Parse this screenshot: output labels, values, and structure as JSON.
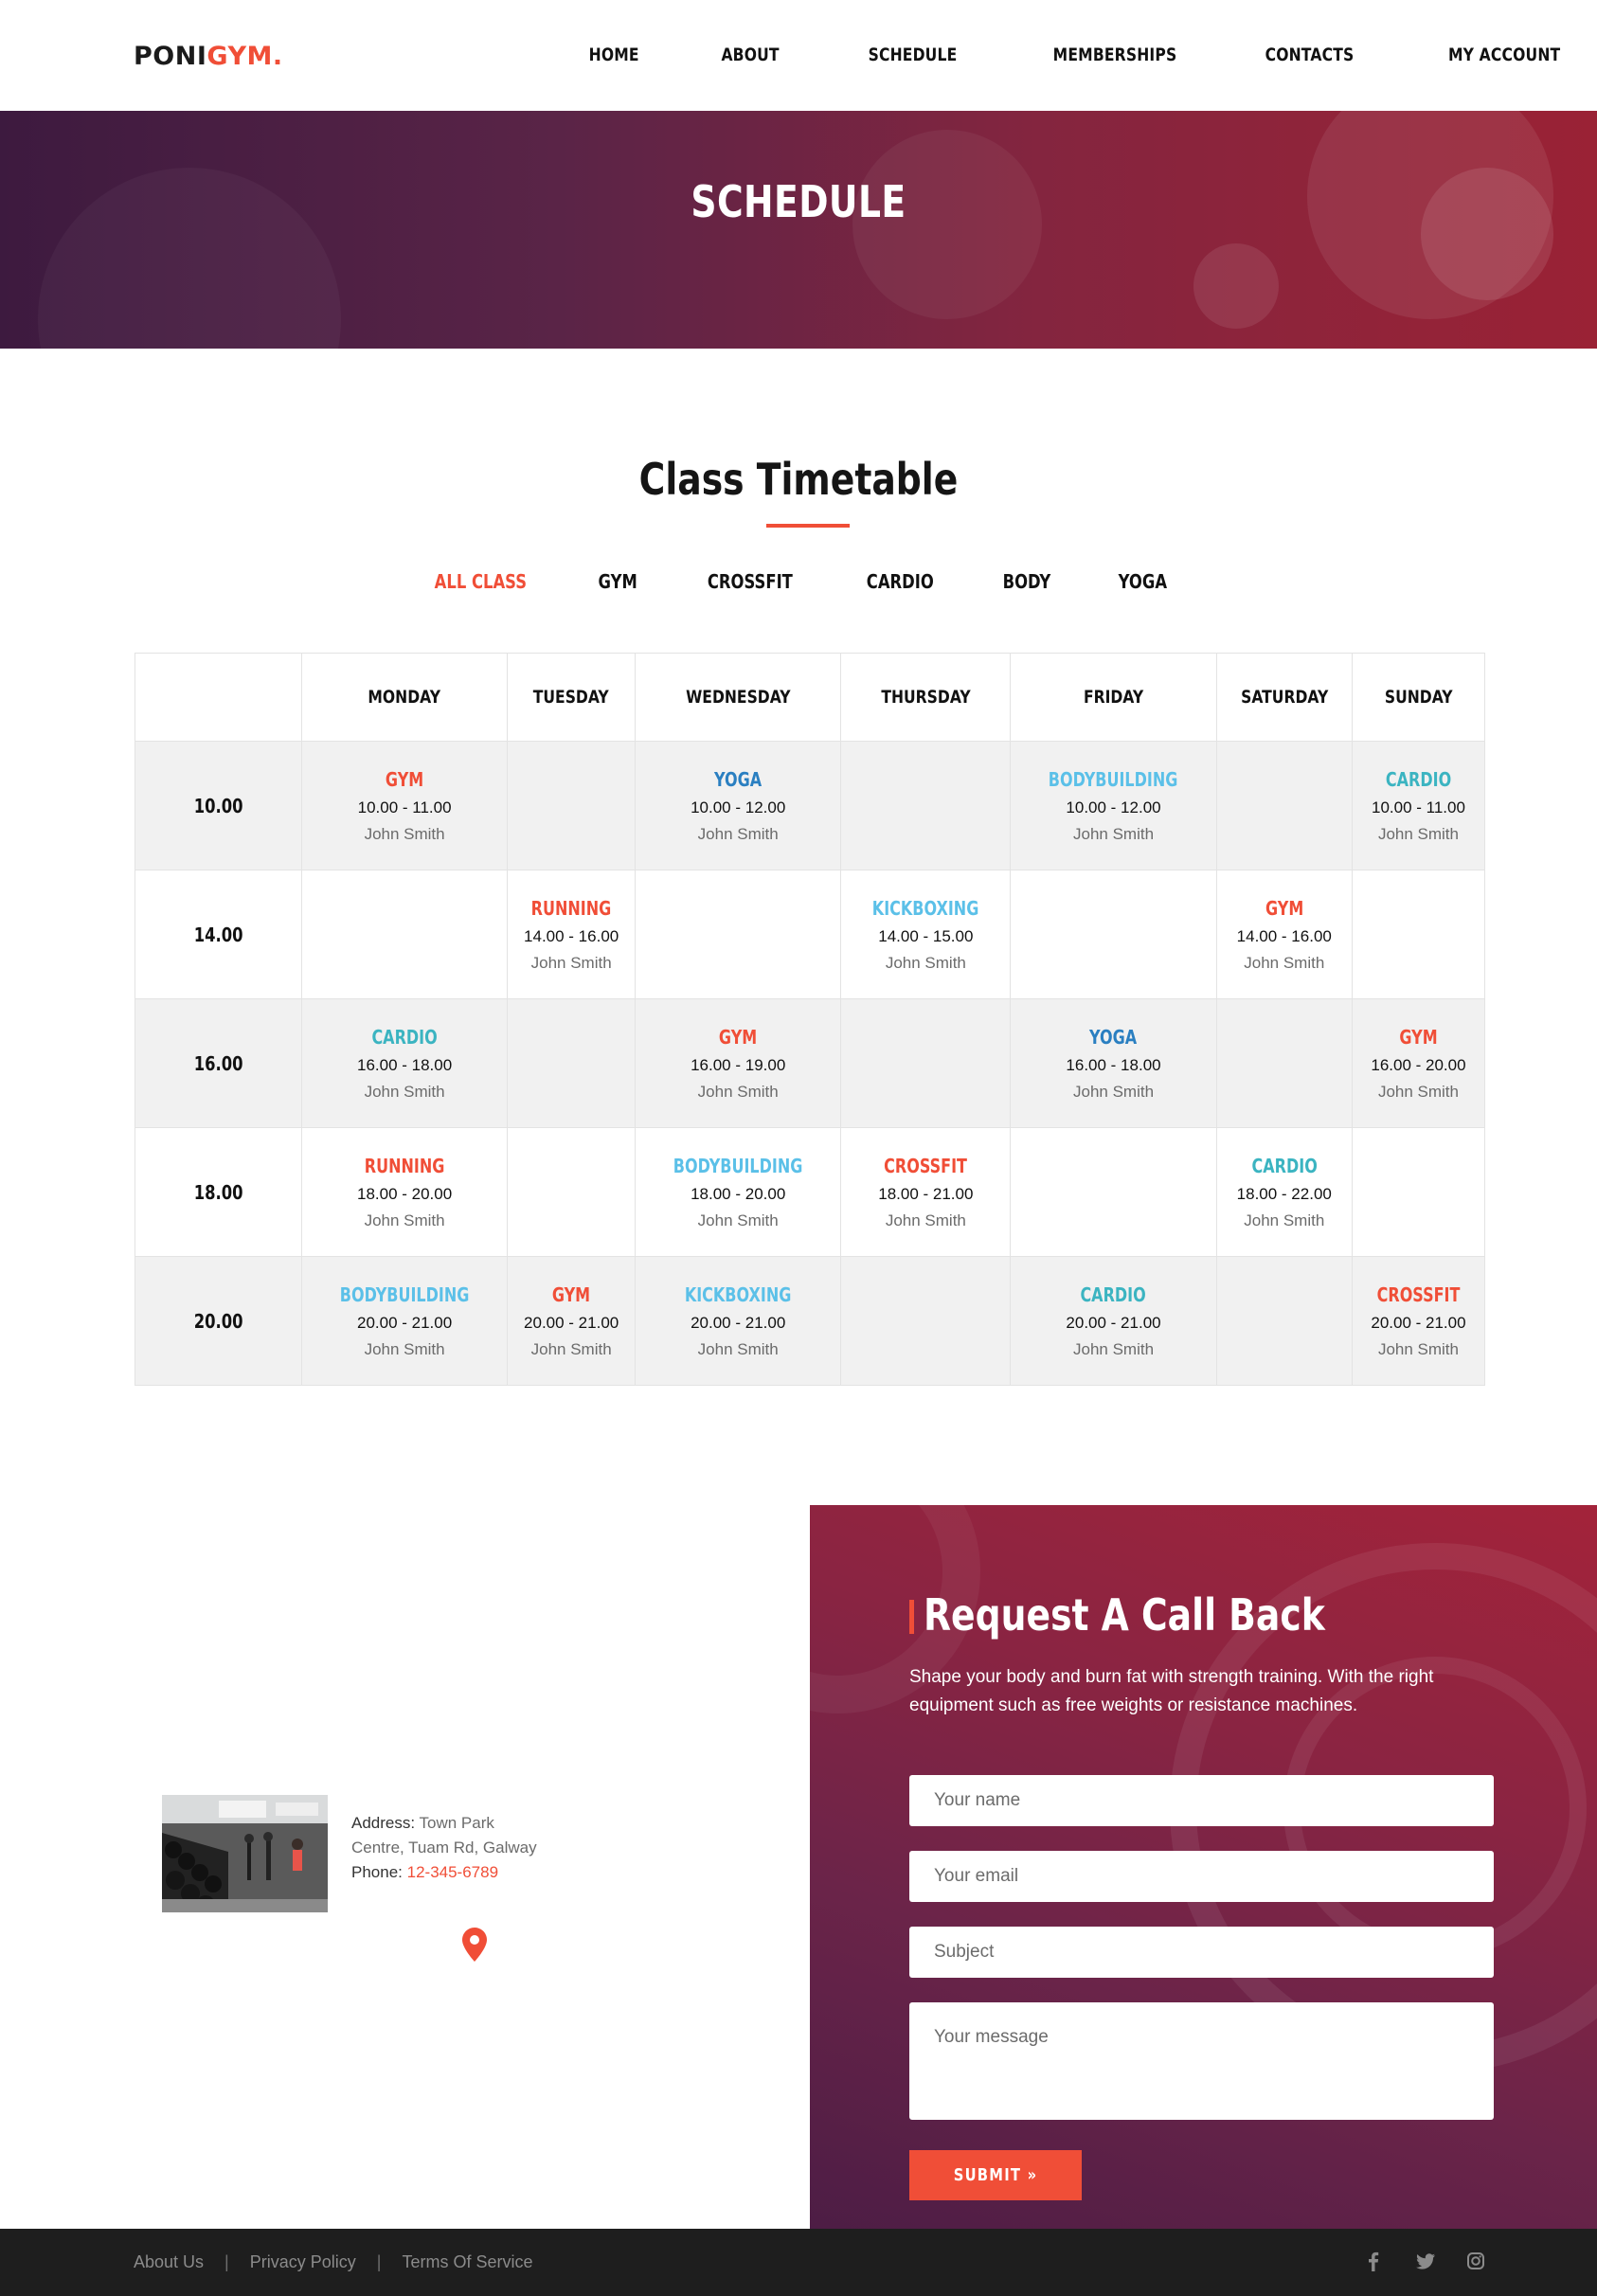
{
  "header": {
    "logo_main": "PONI",
    "logo_accent": "GYM.",
    "nav": [
      "HOME",
      "ABOUT",
      "SCHEDULE",
      "MEMBERSHIPS",
      "CONTACTS",
      "MY ACCOUNT"
    ]
  },
  "banner": {
    "title": "SCHEDULE"
  },
  "timetable": {
    "title": "Class Timetable",
    "filters": [
      "ALL CLASS",
      "GYM",
      "CROSSFIT",
      "CARDIO",
      "BODY",
      "YOGA"
    ],
    "active_filter": "ALL CLASS",
    "days": [
      "MONDAY",
      "TUESDAY",
      "WEDNESDAY",
      "THURSDAY",
      "FRIDAY",
      "SATURDAY",
      "SUNDAY"
    ],
    "rows": [
      {
        "time": "10.00",
        "cells": [
          {
            "name": "GYM",
            "time": "10.00 - 11.00",
            "trainer": "John Smith",
            "color": "#f04e37"
          },
          null,
          {
            "name": "YOGA",
            "time": "10.00 - 12.00",
            "trainer": "John Smith",
            "color": "#2a7fc1"
          },
          null,
          {
            "name": "BODYBUILDING",
            "time": "10.00 - 12.00",
            "trainer": "John Smith",
            "color": "#5bc0e8"
          },
          null,
          {
            "name": "CARDIO",
            "time": "10.00 - 11.00",
            "trainer": "John Smith",
            "color": "#3bb4c1"
          }
        ]
      },
      {
        "time": "14.00",
        "cells": [
          null,
          {
            "name": "RUNNING",
            "time": "14.00 - 16.00",
            "trainer": "John Smith",
            "color": "#f04e37"
          },
          null,
          {
            "name": "KICKBOXING",
            "time": "14.00 - 15.00",
            "trainer": "John Smith",
            "color": "#5bc0e8"
          },
          null,
          {
            "name": "GYM",
            "time": "14.00 - 16.00",
            "trainer": "John Smith",
            "color": "#f04e37"
          },
          null
        ]
      },
      {
        "time": "16.00",
        "cells": [
          {
            "name": "CARDIO",
            "time": "16.00 - 18.00",
            "trainer": "John Smith",
            "color": "#3bb4c1"
          },
          null,
          {
            "name": "GYM",
            "time": "16.00 - 19.00",
            "trainer": "John Smith",
            "color": "#f04e37"
          },
          null,
          {
            "name": "YOGA",
            "time": "16.00 - 18.00",
            "trainer": "John Smith",
            "color": "#2a7fc1"
          },
          null,
          {
            "name": "GYM",
            "time": "16.00 - 20.00",
            "trainer": "John Smith",
            "color": "#f04e37"
          }
        ]
      },
      {
        "time": "18.00",
        "cells": [
          {
            "name": "RUNNING",
            "time": "18.00 - 20.00",
            "trainer": "John Smith",
            "color": "#f04e37"
          },
          null,
          {
            "name": "BODYBUILDING",
            "time": "18.00 - 20.00",
            "trainer": "John Smith",
            "color": "#5bc0e8"
          },
          {
            "name": "CROSSFIT",
            "time": "18.00 - 21.00",
            "trainer": "John Smith",
            "color": "#f04e37"
          },
          null,
          {
            "name": "CARDIO",
            "time": "18.00 - 22.00",
            "trainer": "John Smith",
            "color": "#3bb4c1"
          },
          null
        ]
      },
      {
        "time": "20.00",
        "cells": [
          {
            "name": "BODYBUILDING",
            "time": "20.00 - 21.00",
            "trainer": "John Smith",
            "color": "#5bc0e8"
          },
          {
            "name": "GYM",
            "time": "20.00 - 21.00",
            "trainer": "John Smith",
            "color": "#f04e37"
          },
          {
            "name": "KICKBOXING",
            "time": "20.00 - 21.00",
            "trainer": "John Smith",
            "color": "#5bc0e8"
          },
          null,
          {
            "name": "CARDIO",
            "time": "20.00 - 21.00",
            "trainer": "John Smith",
            "color": "#3bb4c1"
          },
          null,
          {
            "name": "CROSSFIT",
            "time": "20.00 - 21.00",
            "trainer": "John Smith",
            "color": "#f04e37"
          }
        ]
      }
    ]
  },
  "contact": {
    "address_label": "Address:",
    "address_value": "Town Park Centre, Tuam Rd, Galway",
    "phone_label": "Phone:",
    "phone_value": "12-345-6789",
    "map_icon": "map-pin-icon"
  },
  "callback": {
    "title": "Request A Call Back",
    "description": "Shape your body and burn fat with strength training. With the right equipment such as free weights or resistance machines.",
    "name_placeholder": "Your name",
    "email_placeholder": "Your email",
    "subject_placeholder": "Subject",
    "message_placeholder": "Your message",
    "submit_label": "SUBMIT »"
  },
  "footer": {
    "links": [
      "About Us",
      "Privacy Policy",
      "Terms Of Service"
    ],
    "social_icons": [
      "facebook-icon",
      "twitter-icon",
      "instagram-icon"
    ]
  },
  "colors": {
    "accent": "#f04e37",
    "yoga": "#2a7fc1",
    "light_blue": "#5bc0e8",
    "teal": "#3bb4c1",
    "footer_bg": "#1e1e1e"
  }
}
